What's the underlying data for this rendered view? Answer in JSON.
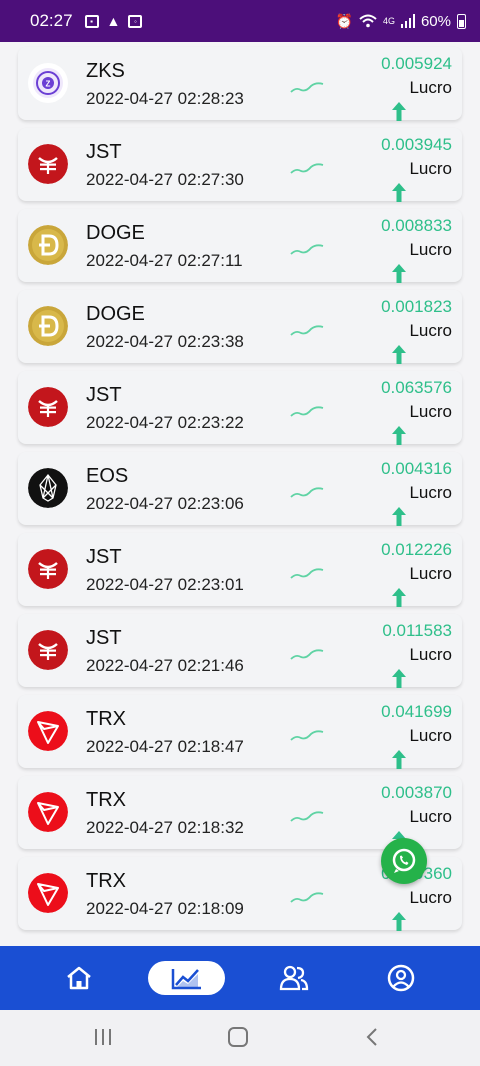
{
  "status_bar": {
    "time": "02:27",
    "battery": "60%",
    "network": "4G"
  },
  "trades": [
    {
      "coin": "ZKS",
      "icon": "zks-coin-icon",
      "datetime": "2022-04-27 02:28:23",
      "amount": "0.005924",
      "result": "Lucro"
    },
    {
      "coin": "JST",
      "icon": "jst-coin-icon",
      "datetime": "2022-04-27 02:27:30",
      "amount": "0.003945",
      "result": "Lucro"
    },
    {
      "coin": "DOGE",
      "icon": "doge-coin-icon",
      "datetime": "2022-04-27 02:27:11",
      "amount": "0.008833",
      "result": "Lucro"
    },
    {
      "coin": "DOGE",
      "icon": "doge-coin-icon",
      "datetime": "2022-04-27 02:23:38",
      "amount": "0.001823",
      "result": "Lucro"
    },
    {
      "coin": "JST",
      "icon": "jst-coin-icon",
      "datetime": "2022-04-27 02:23:22",
      "amount": "0.063576",
      "result": "Lucro"
    },
    {
      "coin": "EOS",
      "icon": "eos-coin-icon",
      "datetime": "2022-04-27 02:23:06",
      "amount": "0.004316",
      "result": "Lucro"
    },
    {
      "coin": "JST",
      "icon": "jst-coin-icon",
      "datetime": "2022-04-27 02:23:01",
      "amount": "0.012226",
      "result": "Lucro"
    },
    {
      "coin": "JST",
      "icon": "jst-coin-icon",
      "datetime": "2022-04-27 02:21:46",
      "amount": "0.011583",
      "result": "Lucro"
    },
    {
      "coin": "TRX",
      "icon": "trx-coin-icon",
      "datetime": "2022-04-27 02:18:47",
      "amount": "0.041699",
      "result": "Lucro"
    },
    {
      "coin": "TRX",
      "icon": "trx-coin-icon",
      "datetime": "2022-04-27 02:18:32",
      "amount": "0.003870",
      "result": "Lucro"
    },
    {
      "coin": "TRX",
      "icon": "trx-coin-icon",
      "datetime": "2022-04-27 02:18:09",
      "amount": "0.009360",
      "result": "Lucro"
    }
  ],
  "bottom_nav": {
    "items": [
      {
        "icon": "home-icon",
        "active": false
      },
      {
        "icon": "chart-icon",
        "active": true
      },
      {
        "icon": "team-icon",
        "active": false
      },
      {
        "icon": "profile-icon",
        "active": false
      }
    ]
  },
  "colors": {
    "status_bar": "#4c0f7a",
    "nav_bar": "#1a4fd3",
    "profit": "#2ebf8a",
    "whatsapp": "#25b24a"
  }
}
